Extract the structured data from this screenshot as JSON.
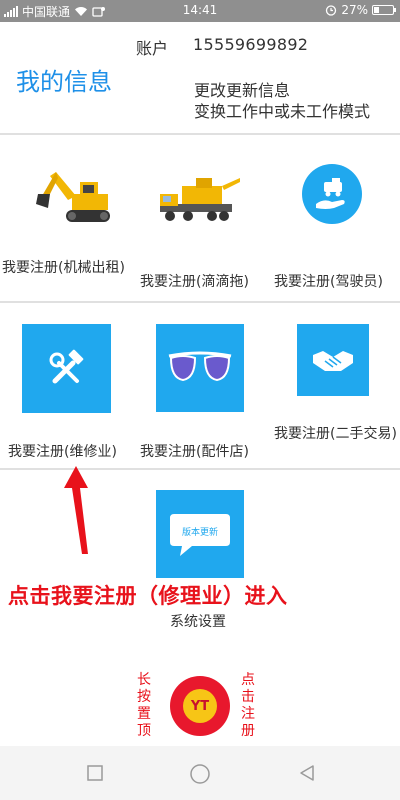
{
  "status_bar": {
    "carrier": "中国联通",
    "time": "14:41",
    "battery_percent": "27%",
    "battery_level": 0.27,
    "icons": [
      "signal-icon",
      "wifi-icon",
      "alarm-icon",
      "battery-icon"
    ]
  },
  "header": {
    "account_label": "账户",
    "account_value": "15559699892",
    "title": "我的信息",
    "update_line1": "更改更新信息",
    "update_line2": "变换工作中或未工作模式"
  },
  "grid": {
    "row1": [
      {
        "label": "我要注册(机械出租)",
        "icon": "excavator-icon"
      },
      {
        "label": "我要注册(滴滴拖)",
        "icon": "tow-truck-icon"
      },
      {
        "label": "我要注册(驾驶员)",
        "icon": "driver-hand-icon"
      }
    ],
    "row2": [
      {
        "label": "我要注册(维修业)",
        "icon": "wrench-hammer-icon"
      },
      {
        "label": "我要注册(配件店)",
        "icon": "sunglasses-icon"
      },
      {
        "label": "我要注册(二手交易)",
        "icon": "handshake-icon"
      }
    ],
    "settings": {
      "label": "系统设置",
      "icon_text": "版本更新",
      "icon": "chat-bubble-icon"
    }
  },
  "annotation": {
    "text": "点击我要注册（修理业）进入",
    "left_vertical": "长按置顶",
    "right_vertical": "点击注册"
  },
  "fab": {
    "logo_text": "YT"
  },
  "colors": {
    "title_blue": "#1e90e8",
    "tile_blue": "#20a8ee",
    "annotation_red": "#e8121b",
    "fab_red": "#e8182d",
    "logo_yellow": "#f7c516"
  },
  "nav_bar": {
    "icons": [
      "recent-apps-icon",
      "home-icon",
      "back-icon"
    ]
  }
}
